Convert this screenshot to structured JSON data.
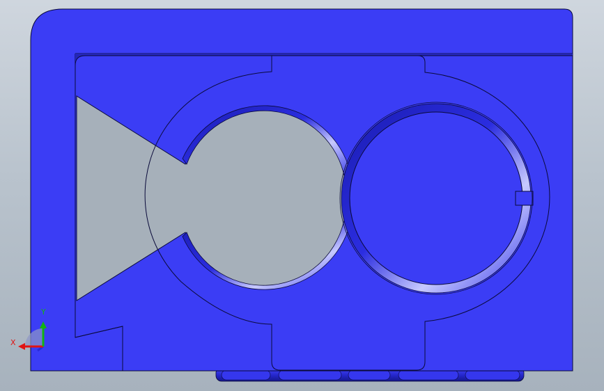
{
  "viewport": {
    "colors": {
      "part_body": "#3b3df5",
      "part_edge": "#0a0a3a",
      "cavity_gray": "#a6b0ba",
      "axis_x": "#e01414",
      "axis_y": "#12b512",
      "axis_z": "#2a2ad8"
    }
  },
  "triad": {
    "x_label": "X",
    "y_label": "Y",
    "icons": [
      "axis-x-arrow-icon",
      "axis-y-arrow-icon",
      "axis-z-arrow-icon"
    ]
  }
}
